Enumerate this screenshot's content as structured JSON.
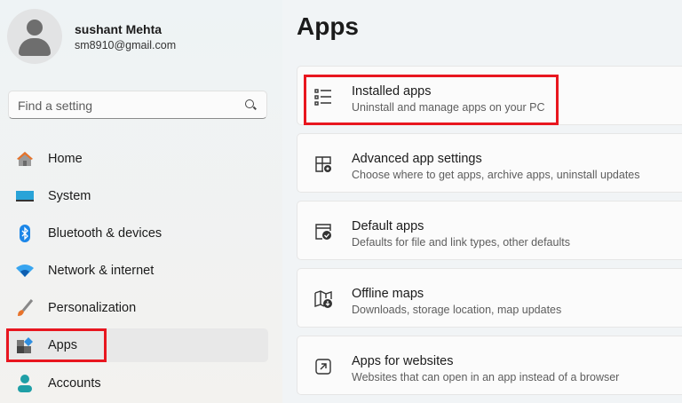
{
  "user": {
    "name": "sushant Mehta",
    "email": "sm8910@gmail.com"
  },
  "search": {
    "placeholder": "Find a setting"
  },
  "nav": [
    {
      "label": "Home",
      "icon": "home-icon"
    },
    {
      "label": "System",
      "icon": "system-icon"
    },
    {
      "label": "Bluetooth & devices",
      "icon": "bluetooth-icon"
    },
    {
      "label": "Network & internet",
      "icon": "wifi-icon"
    },
    {
      "label": "Personalization",
      "icon": "brush-icon"
    },
    {
      "label": "Apps",
      "icon": "apps-icon",
      "selected": true
    },
    {
      "label": "Accounts",
      "icon": "accounts-icon"
    }
  ],
  "page": {
    "title": "Apps"
  },
  "cards": [
    {
      "title": "Installed apps",
      "subtitle": "Uninstall and manage apps on your PC",
      "icon": "list-icon"
    },
    {
      "title": "Advanced app settings",
      "subtitle": "Choose where to get apps, archive apps, uninstall updates",
      "icon": "app-settings-icon"
    },
    {
      "title": "Default apps",
      "subtitle": "Defaults for file and link types, other defaults",
      "icon": "default-apps-icon"
    },
    {
      "title": "Offline maps",
      "subtitle": "Downloads, storage location, map updates",
      "icon": "map-icon"
    },
    {
      "title": "Apps for websites",
      "subtitle": "Websites that can open in an app instead of a browser",
      "icon": "open-link-icon"
    }
  ],
  "colors": {
    "highlight": "#e8161f",
    "accent": "#0067c0"
  }
}
